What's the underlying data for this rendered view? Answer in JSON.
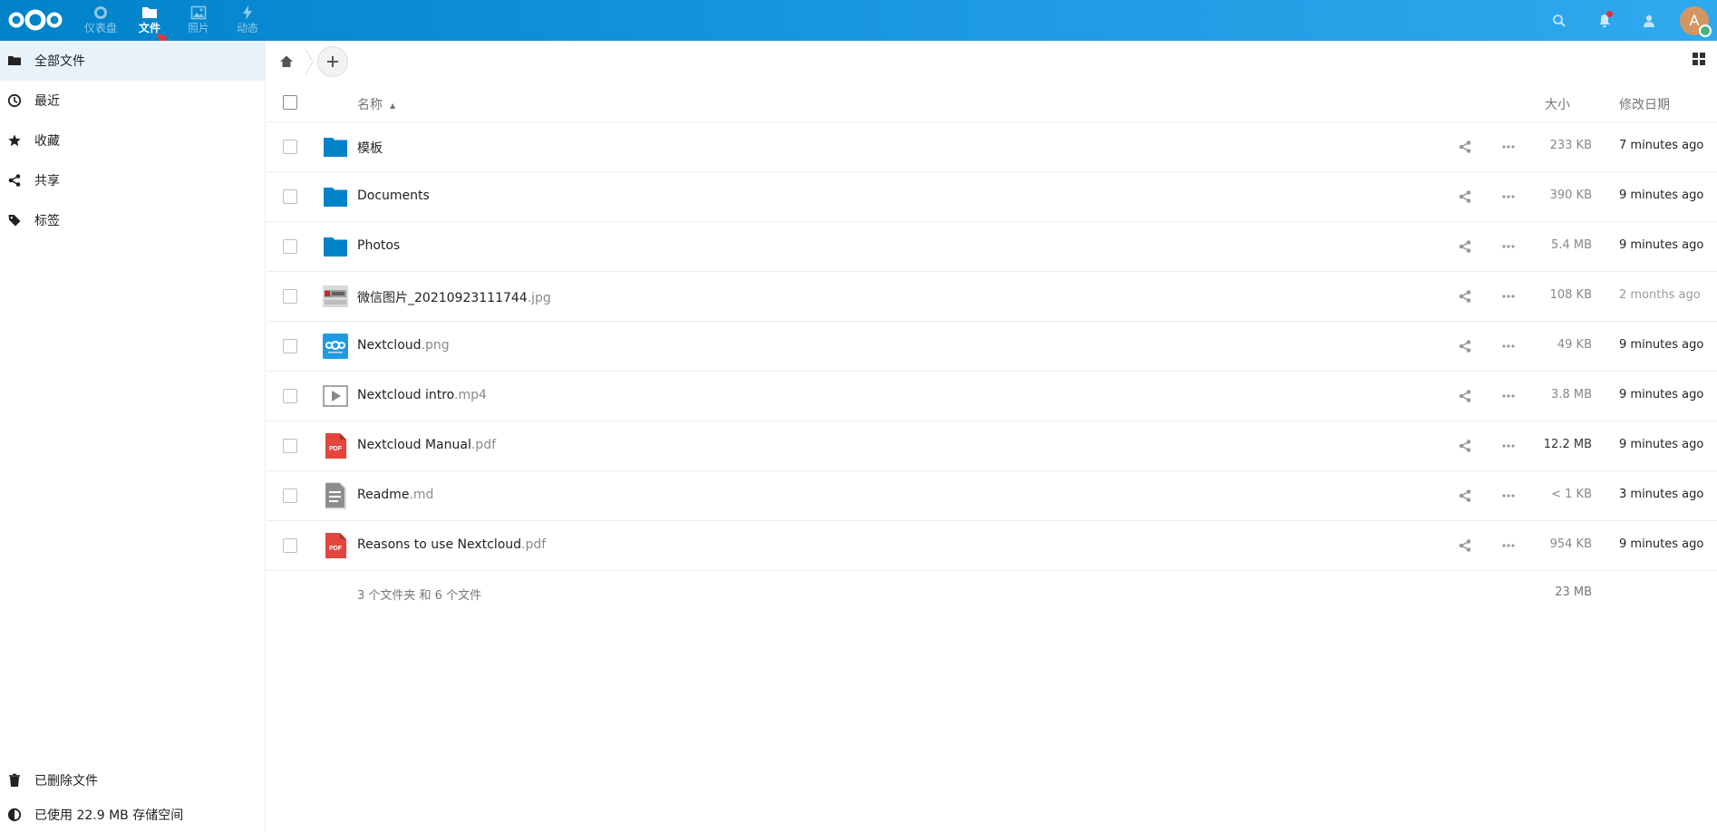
{
  "header": {
    "apps": [
      {
        "label": "仪表盘",
        "icon": "dashboard-icon"
      },
      {
        "label": "文件",
        "icon": "folder-icon"
      },
      {
        "label": "照片",
        "icon": "image-icon"
      },
      {
        "label": "动态",
        "icon": "activity-icon"
      }
    ],
    "avatar_initial": "A",
    "accent": "#0082c9"
  },
  "sidebar": {
    "items": [
      {
        "label": "全部文件",
        "icon": "folder-icon"
      },
      {
        "label": "最近",
        "icon": "clock-icon"
      },
      {
        "label": "收藏",
        "icon": "star-icon"
      },
      {
        "label": "共享",
        "icon": "share-icon"
      },
      {
        "label": "标签",
        "icon": "tag-icon"
      }
    ],
    "bottom": {
      "trash": "已删除文件",
      "quota": "已使用 22.9 MB 存储空间"
    }
  },
  "table": {
    "headers": {
      "name": "名称",
      "size": "大小",
      "modified": "修改日期"
    },
    "rows": [
      {
        "name": "模板",
        "ext": "",
        "type": "folder",
        "size": "233 KB",
        "modified": "7 minutes ago"
      },
      {
        "name": "Documents",
        "ext": "",
        "type": "folder",
        "size": "390 KB",
        "modified": "9 minutes ago"
      },
      {
        "name": "Photos",
        "ext": "",
        "type": "folder",
        "size": "5.4 MB",
        "modified": "9 minutes ago"
      },
      {
        "name": "微信图片_20210923111744",
        "ext": ".jpg",
        "type": "image",
        "size": "108 KB",
        "modified": "2 months ago"
      },
      {
        "name": "Nextcloud",
        "ext": ".png",
        "type": "png",
        "size": "49 KB",
        "modified": "9 minutes ago"
      },
      {
        "name": "Nextcloud intro",
        "ext": ".mp4",
        "type": "video",
        "size": "3.8 MB",
        "modified": "9 minutes ago"
      },
      {
        "name": "Nextcloud Manual",
        "ext": ".pdf",
        "type": "pdf",
        "size": "12.2 MB",
        "modified": "9 minutes ago"
      },
      {
        "name": "Readme",
        "ext": ".md",
        "type": "text",
        "size": "< 1 KB",
        "modified": "3 minutes ago"
      },
      {
        "name": "Reasons to use Nextcloud",
        "ext": ".pdf",
        "type": "pdf",
        "size": "954 KB",
        "modified": "9 minutes ago"
      }
    ],
    "summary": {
      "text": "3 个文件夹 和 6 个文件",
      "size": "23 MB"
    }
  }
}
